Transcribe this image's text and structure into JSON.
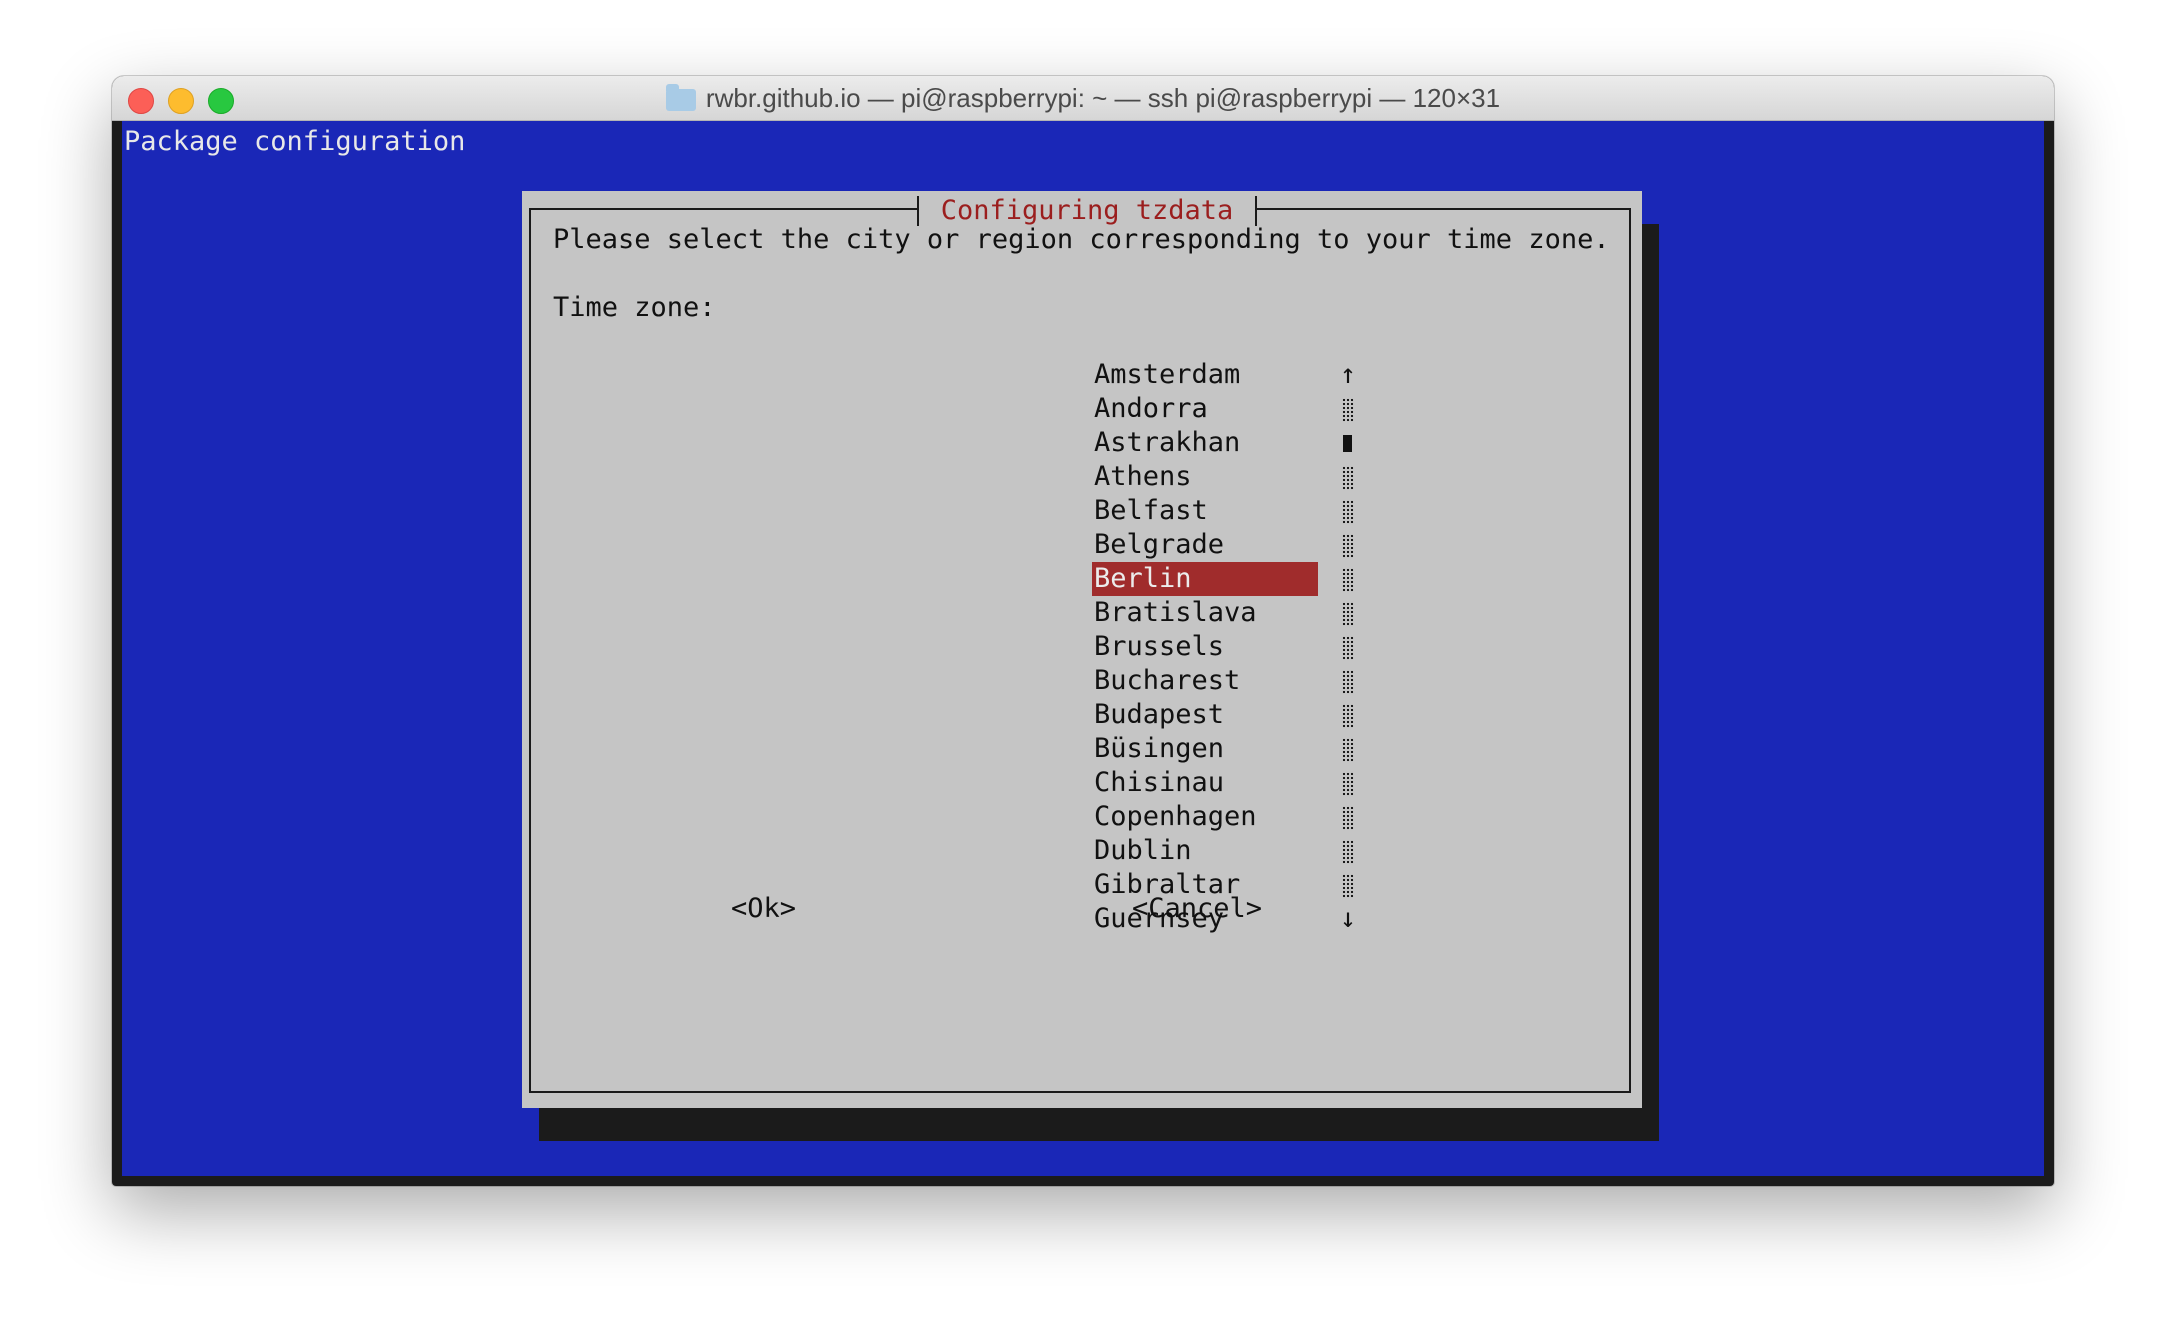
{
  "window": {
    "title": "rwbr.github.io — pi@raspberrypi: ~ — ssh pi@raspberrypi — 120×31",
    "traffic_lights": [
      "close",
      "minimize",
      "zoom"
    ],
    "colors": {
      "terminal_bg": "#1a27b7",
      "dialog_bg": "#c5c5c5",
      "selection": "#a02c2c",
      "dialog_title": "#9b1e1e"
    }
  },
  "terminal": {
    "header": "Package configuration"
  },
  "dialog": {
    "title": "Configuring tzdata",
    "prompt": "Please select the city or region corresponding to your time zone.",
    "field_label": "Time zone:",
    "timezones": [
      "Amsterdam",
      "Andorra",
      "Astrakhan",
      "Athens",
      "Belfast",
      "Belgrade",
      "Berlin",
      "Bratislava",
      "Brussels",
      "Bucharest",
      "Budapest",
      "Büsingen",
      "Chisinau",
      "Copenhagen",
      "Dublin",
      "Gibraltar",
      "Guernsey"
    ],
    "selected": "Berlin",
    "scrollbar": {
      "up_arrow": "↑",
      "down_arrow": "↓",
      "thumb_row": 2
    },
    "ok_label": "<Ok>",
    "cancel_label": "<Cancel>"
  }
}
